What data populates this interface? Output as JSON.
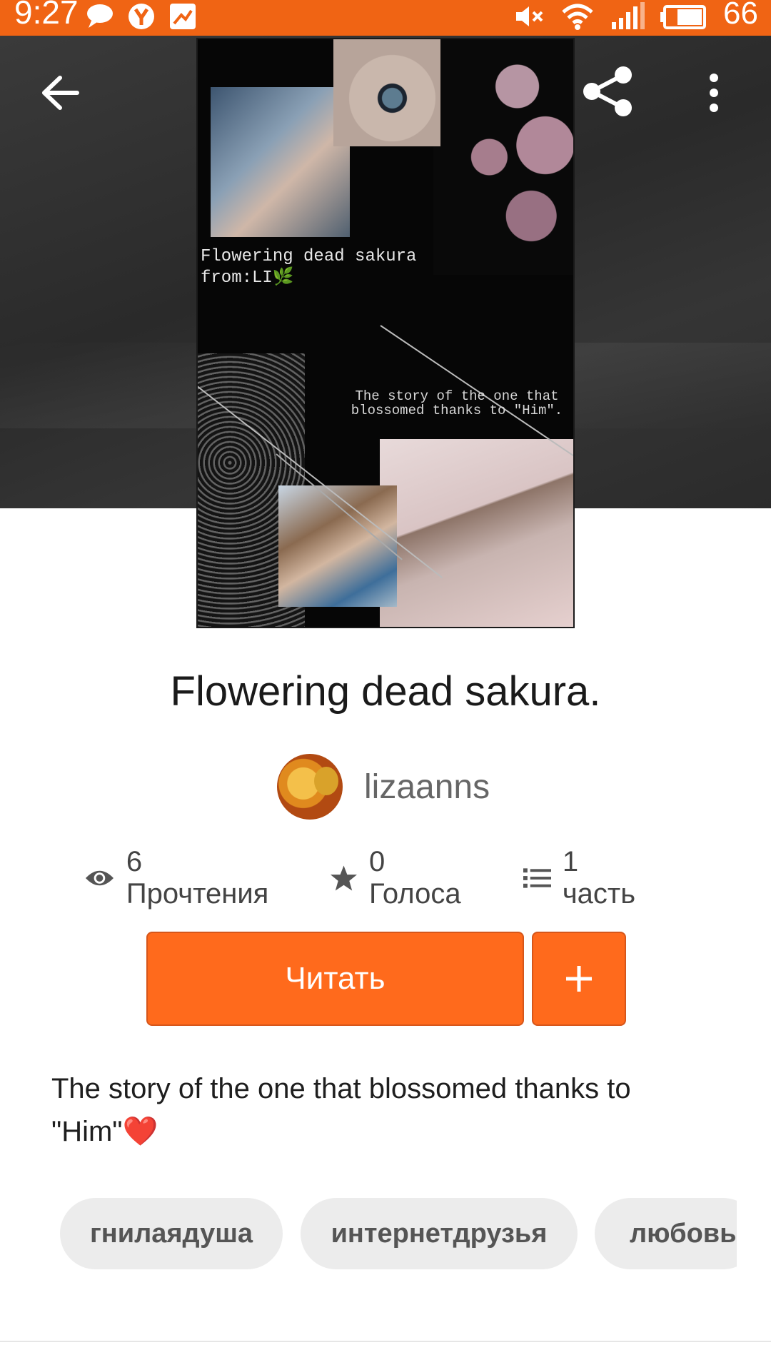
{
  "status_bar": {
    "time": "9:27",
    "battery": "66",
    "icons": [
      "chat-bubble-icon",
      "yandex-icon",
      "gallery-icon",
      "mute-icon",
      "wifi-icon",
      "signal-icon",
      "battery-icon"
    ]
  },
  "header": {
    "back_icon": "arrow-left-icon",
    "share_icon": "share-icon",
    "more_icon": "more-vert-icon"
  },
  "cover": {
    "title_line1": "Flowering dead sakura",
    "title_line2": "from:LI",
    "subtitle": "The story of the one that blossomed thanks to \"Him\"."
  },
  "story": {
    "title": "Flowering dead sakura.",
    "author": "lizaanns",
    "description": "The story of the one that blossomed thanks to \"Him\"❤️"
  },
  "stats": {
    "reads": "6 Прочтения",
    "votes": "0 Голоса",
    "parts": "1 часть"
  },
  "actions": {
    "read_label": "Читать",
    "add_icon": "plus-icon"
  },
  "tags": [
    "гнилаядуша",
    "интернетдрузья",
    "любовь"
  ],
  "colors": {
    "accent": "#ff6a1c",
    "status_bar": "#f06414"
  }
}
